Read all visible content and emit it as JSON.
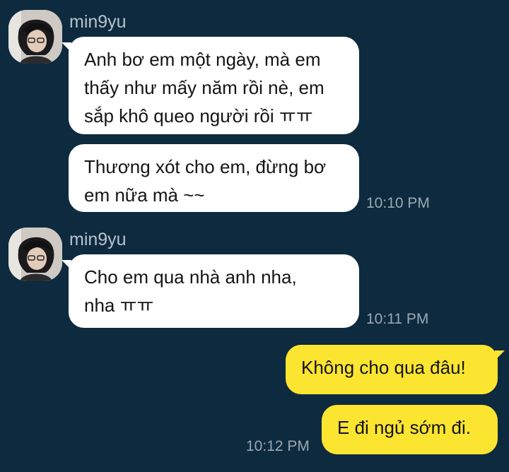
{
  "thread": {
    "groups": [
      {
        "sender": "min9yu",
        "messages": [
          "Anh bơ em một ngày, mà em\nthấy như mấy năm rồi nè, em\nsắp khô queo người rồi ㅠㅠ",
          "Thương xót cho em, đừng bơ\nem nữa mà ~~"
        ],
        "time": "10:10 PM"
      },
      {
        "sender": "min9yu",
        "messages": [
          "Cho em qua nhà anh nha,\nnha ㅠㅠ"
        ],
        "time": "10:11 PM"
      },
      {
        "sender": "",
        "messages": [
          "Không cho qua đâu!",
          "E đi ngủ sớm đi."
        ],
        "time": "10:12 PM"
      }
    ]
  },
  "colors": {
    "background": "#0e2a3f",
    "incoming_bubble": "#ffffff",
    "outgoing_bubble": "#fce530"
  },
  "icons": {
    "avatar": "profile-photo"
  }
}
